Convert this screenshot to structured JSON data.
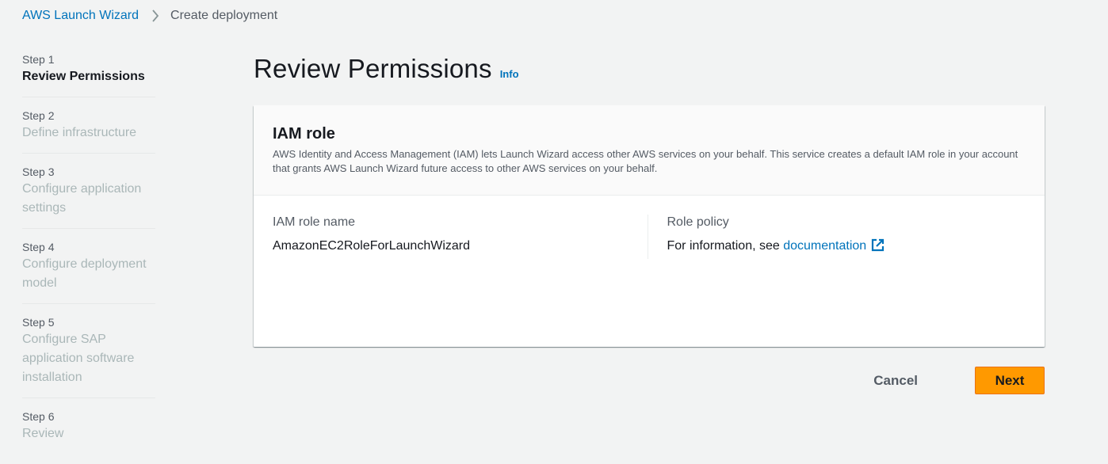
{
  "breadcrumb": {
    "items": [
      {
        "label": "AWS Launch Wizard"
      },
      {
        "label": "Create deployment"
      }
    ],
    "separator_icon": "chevron-right-icon"
  },
  "steps": [
    {
      "num": "Step 1",
      "title": "Review Permissions",
      "active": true
    },
    {
      "num": "Step 2",
      "title": "Define infrastructure",
      "active": false
    },
    {
      "num": "Step 3",
      "title": "Configure application settings",
      "active": false
    },
    {
      "num": "Step 4",
      "title": "Configure deployment model",
      "active": false
    },
    {
      "num": "Step 5",
      "title": "Configure SAP application software installation",
      "active": false
    },
    {
      "num": "Step 6",
      "title": "Review",
      "active": false
    }
  ],
  "header": {
    "title": "Review Permissions",
    "info": "Info"
  },
  "card": {
    "title": "IAM role",
    "description": "AWS Identity and Access Management (IAM) lets Launch Wizard access other AWS services on your behalf. This service creates a default IAM role in your account that grants AWS Launch Wizard future access to other AWS services on your behalf.",
    "role_name_label": "IAM role name",
    "role_name_value": "AmazonEC2RoleForLaunchWizard",
    "policy_label": "Role policy",
    "policy_prefix": "For information, see ",
    "policy_link": "documentation",
    "policy_link_icon": "external-link-icon"
  },
  "actions": {
    "cancel": "Cancel",
    "next": "Next"
  },
  "colors": {
    "link": "#0073bb",
    "primary_button": "#ff9900",
    "background": "#f2f3f3",
    "muted_text": "#aab7b8"
  }
}
